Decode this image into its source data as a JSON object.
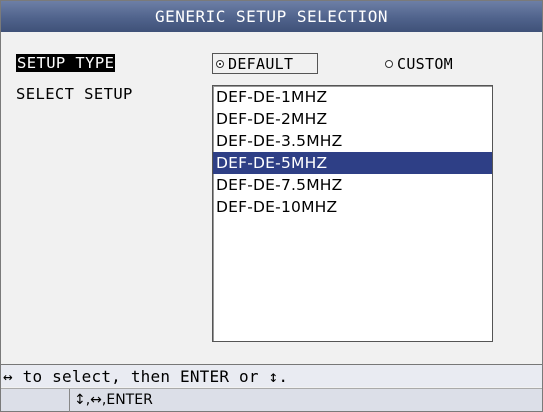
{
  "window": {
    "title": "GENERIC SETUP SELECTION"
  },
  "setup_type": {
    "label": "SETUP TYPE",
    "options": [
      {
        "label": "DEFAULT",
        "selected": true
      },
      {
        "label": "CUSTOM",
        "selected": false
      }
    ]
  },
  "select_setup": {
    "label": "SELECT SETUP",
    "items": [
      "DEF-DE-1MHZ",
      "DEF-DE-2MHZ",
      "DEF-DE-3.5MHZ",
      "DEF-DE-5MHZ",
      "DEF-DE-7.5MHZ",
      "DEF-DE-10MHZ"
    ],
    "selected": "DEF-DE-5MHZ"
  },
  "hint": {
    "text": "↔ to select, then ENTER or ↕."
  },
  "keys": {
    "text": "↕,↔,ENTER"
  },
  "colors": {
    "titlebar": "#50638c",
    "selection": "#2e3f86",
    "background": "#f1f1f1"
  }
}
